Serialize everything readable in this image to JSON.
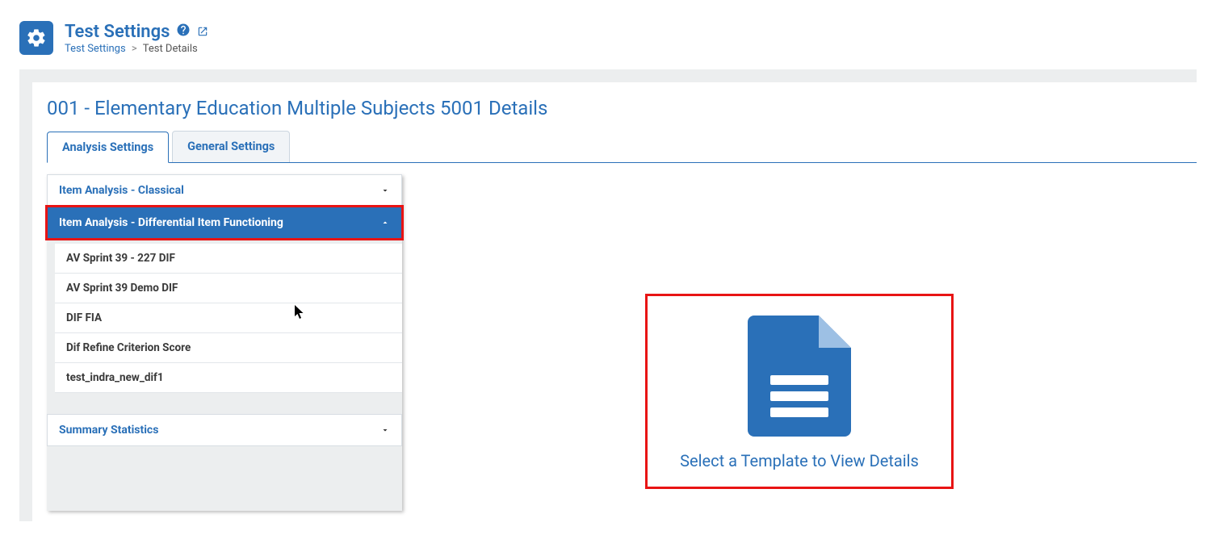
{
  "header": {
    "title": "Test Settings",
    "breadcrumb_link": "Test Settings",
    "breadcrumb_sep": ">",
    "breadcrumb_current": "Test Details"
  },
  "detail_title": "001 - Elementary Education Multiple Subjects 5001 Details",
  "tabs": {
    "analysis": "Analysis Settings",
    "general": "General Settings"
  },
  "accordion": {
    "classical": "Item Analysis - Classical",
    "dif": "Item Analysis - Differential Item Functioning",
    "summary": "Summary Statistics",
    "dif_items": [
      "AV Sprint 39 - 227 DIF",
      "AV Sprint 39 Demo DIF",
      "DIF FIA",
      "Dif Refine Criterion Score",
      "test_indra_new_dif1"
    ]
  },
  "right": {
    "prompt": "Select a Template to View Details"
  },
  "colors": {
    "accent": "#2a70b8",
    "highlight": "#e81414"
  }
}
